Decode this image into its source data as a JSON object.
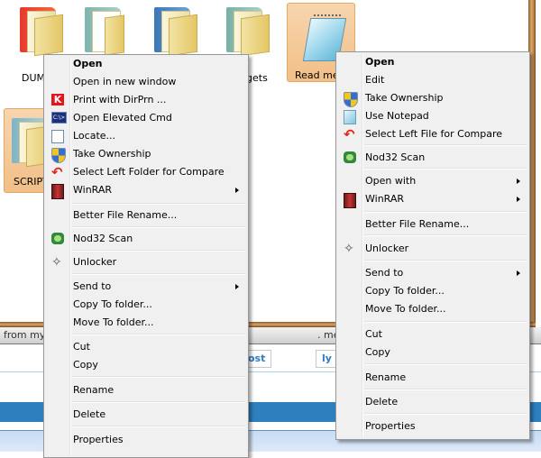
{
  "desktop": {
    "icons": [
      {
        "label": "DUM",
        "selected": false
      },
      {
        "label": "",
        "selected": false
      },
      {
        "label": "",
        "selected": false
      },
      {
        "label": "gets",
        "selected": false
      },
      {
        "label": "Read me.",
        "selected": true
      },
      {
        "label": "SCRIPT",
        "selected": true
      }
    ]
  },
  "browser": {
    "strip_left_text": "from my",
    "strip_right_text": ". me",
    "button_left": "ost",
    "button_right": "ly"
  },
  "folder_menu": {
    "items": [
      {
        "label": "Open",
        "bold": true,
        "icon": null,
        "submenu": false
      },
      {
        "label": "Open in new window",
        "icon": null,
        "submenu": false
      },
      {
        "label": "Print with DirPrn ...",
        "icon": "dirprn-k-icon",
        "submenu": false
      },
      {
        "label": "Open Elevated Cmd",
        "icon": "cmd-icon",
        "submenu": false
      },
      {
        "label": "Locate...",
        "icon": "locate-icon",
        "submenu": false
      },
      {
        "label": "Take Ownership",
        "icon": "uac-shield-icon",
        "submenu": false
      },
      {
        "label": "Select Left Folder for Compare",
        "icon": "compare-arrow-icon",
        "submenu": false
      },
      {
        "label": "WinRAR",
        "icon": "winrar-icon",
        "submenu": true
      },
      {
        "label": "Better File Rename...",
        "icon": null,
        "submenu": false
      },
      {
        "label": "Nod32 Scan",
        "icon": "nod32-icon",
        "submenu": false
      },
      {
        "label": "Unlocker",
        "icon": "unlocker-wand-icon",
        "submenu": false
      },
      {
        "label": "Send to",
        "icon": null,
        "submenu": true
      },
      {
        "label": "Copy To folder...",
        "icon": null,
        "submenu": false
      },
      {
        "label": "Move To folder...",
        "icon": null,
        "submenu": false
      },
      {
        "label": "Cut",
        "icon": null,
        "submenu": false
      },
      {
        "label": "Copy",
        "icon": null,
        "submenu": false
      },
      {
        "label": "Rename",
        "icon": null,
        "submenu": false
      },
      {
        "label": "Delete",
        "icon": null,
        "submenu": false
      },
      {
        "label": "Properties",
        "icon": null,
        "submenu": false
      }
    ]
  },
  "file_menu": {
    "items": [
      {
        "label": "Open",
        "bold": true,
        "icon": null,
        "submenu": false
      },
      {
        "label": "Edit",
        "icon": null,
        "submenu": false
      },
      {
        "label": "Take Ownership",
        "icon": "uac-shield-icon",
        "submenu": false
      },
      {
        "label": "Use Notepad",
        "icon": "notepad-icon",
        "submenu": false
      },
      {
        "label": "Select Left File for Compare",
        "icon": "compare-arrow-icon",
        "submenu": false
      },
      {
        "label": "Nod32 Scan",
        "icon": "nod32-icon",
        "submenu": false
      },
      {
        "label": "Open with",
        "icon": null,
        "submenu": true
      },
      {
        "label": "WinRAR",
        "icon": "winrar-icon",
        "submenu": true
      },
      {
        "label": "Better File Rename...",
        "icon": null,
        "submenu": false
      },
      {
        "label": "Unlocker",
        "icon": "unlocker-wand-icon",
        "submenu": false
      },
      {
        "label": "Send to",
        "icon": null,
        "submenu": true
      },
      {
        "label": "Copy To folder...",
        "icon": null,
        "submenu": false
      },
      {
        "label": "Move To folder...",
        "icon": null,
        "submenu": false
      },
      {
        "label": "Cut",
        "icon": null,
        "submenu": false
      },
      {
        "label": "Copy",
        "icon": null,
        "submenu": false
      },
      {
        "label": "Rename",
        "icon": null,
        "submenu": false
      },
      {
        "label": "Delete",
        "icon": null,
        "submenu": false
      },
      {
        "label": "Properties",
        "icon": null,
        "submenu": false
      }
    ]
  },
  "colors": {
    "menu_bg": "#f0f0f0",
    "selection_orange": "#f2bf87",
    "frame_brown": "#c68a4c",
    "browser_blue": "#2e7fbd"
  }
}
